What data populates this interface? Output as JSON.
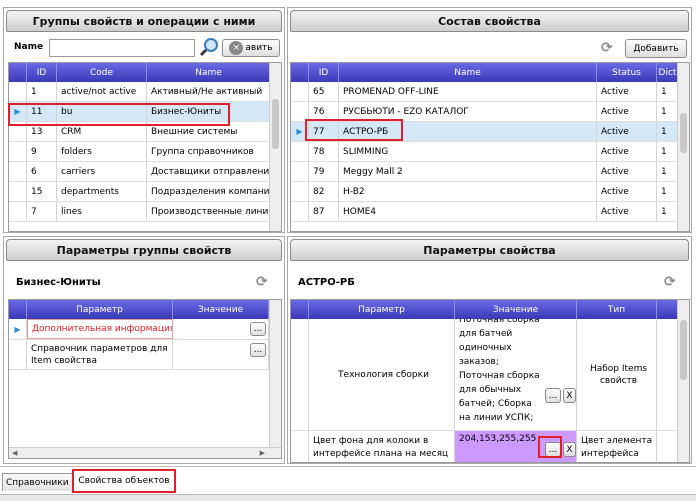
{
  "left_top": {
    "title": "Группы свойств и операции с ними",
    "name_label": "Name",
    "name_value": "",
    "add_button": "авить",
    "columns": [
      "ID",
      "Code",
      "Name"
    ],
    "rows": [
      {
        "id": "1",
        "code": "active/not active",
        "name": "Активный/Не активный"
      },
      {
        "id": "11",
        "code": "bu",
        "name": "Бизнес-Юниты",
        "selected": true
      },
      {
        "id": "13",
        "code": "CRM",
        "name": "Внешние системы"
      },
      {
        "id": "9",
        "code": "folders",
        "name": "Группа справочников"
      },
      {
        "id": "6",
        "code": "carriers",
        "name": "Доставщики отправлений"
      },
      {
        "id": "15",
        "code": "departments",
        "name": "Подразделения компании"
      },
      {
        "id": "7",
        "code": "lines",
        "name": "Производственные линии"
      }
    ]
  },
  "right_top": {
    "title": "Состав свойства",
    "add_button": "Добавить",
    "columns": [
      "ID",
      "Name",
      "Status",
      "Dict"
    ],
    "rows": [
      {
        "id": "65",
        "name": "PROMENAD OFF-LINE",
        "status": "Active",
        "dict": "1"
      },
      {
        "id": "76",
        "name": "РУСБЬЮТИ - EZO КАТАЛОГ",
        "status": "Active",
        "dict": "1"
      },
      {
        "id": "77",
        "name": "АСТРО-РБ",
        "status": "Active",
        "dict": "1",
        "selected": true
      },
      {
        "id": "78",
        "name": "SLIMMING",
        "status": "Active",
        "dict": "1"
      },
      {
        "id": "79",
        "name": "Meggy Mall 2",
        "status": "Active",
        "dict": "1"
      },
      {
        "id": "82",
        "name": "H-B2",
        "status": "Active",
        "dict": "1"
      },
      {
        "id": "87",
        "name": "HOME4",
        "status": "Active",
        "dict": "1"
      }
    ]
  },
  "left_bottom": {
    "title": "Параметры группы свойств",
    "subtitle": "Бизнес-Юниты",
    "columns": [
      "Параметр",
      "Значение"
    ],
    "rows": [
      {
        "param": "Дополнительная информация",
        "value": "",
        "highlight": true
      },
      {
        "param": "Справочник параметров для Item свойства",
        "value": ""
      }
    ],
    "dots": "..."
  },
  "right_bottom": {
    "title": "Параметры свойства",
    "subtitle": "АСТРО-РБ",
    "columns": [
      "Параметр",
      "Значение",
      "Тип"
    ],
    "rows": [
      {
        "param": "Технология сборки",
        "value": "Поточная сборка для батчей одиночных заказов; Поточная сборка для обычных батчей; Сборка на линии УСПК;",
        "type": "Набор Items свойств"
      },
      {
        "param": "Цвет фона для колоки в интерфейсе плана на месяц",
        "value": "204,153,255,255",
        "type": "Цвет элемента интерфейса",
        "color": "#cc99ff"
      }
    ],
    "dots": "...",
    "x": "X"
  },
  "tabs": [
    "Справочники",
    "Свойства объектов"
  ],
  "colors": {
    "header": "#4a4ad0",
    "selection": "#d4e8f8",
    "highlight": "#e0202a"
  }
}
